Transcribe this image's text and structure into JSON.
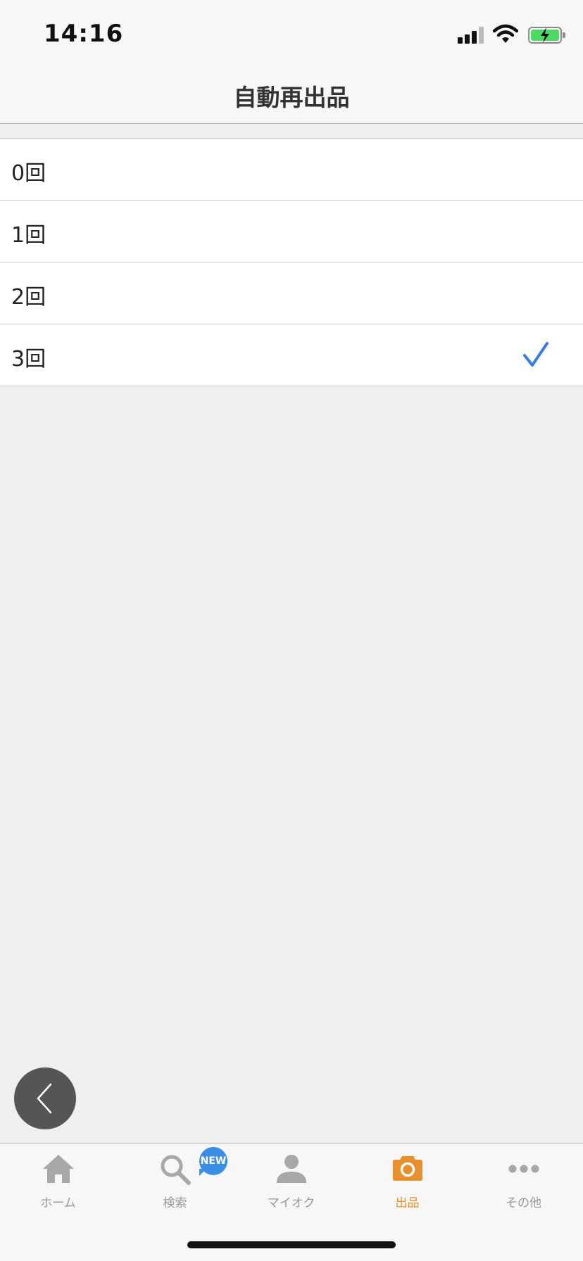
{
  "status_bar": {
    "time": "14:16"
  },
  "nav": {
    "title": "自動再出品"
  },
  "options": [
    {
      "label": "0回",
      "selected": false
    },
    {
      "label": "1回",
      "selected": false
    },
    {
      "label": "2回",
      "selected": false
    },
    {
      "label": "3回",
      "selected": true
    }
  ],
  "tabs": [
    {
      "label": "ホーム",
      "icon": "home-icon"
    },
    {
      "label": "検索",
      "icon": "search-icon",
      "badge": "NEW"
    },
    {
      "label": "マイオク",
      "icon": "person-icon"
    },
    {
      "label": "出品",
      "icon": "camera-icon",
      "active": true
    },
    {
      "label": "その他",
      "icon": "more-icon"
    }
  ],
  "colors": {
    "accent_active": "#e8902e",
    "check": "#3a7be0",
    "badge": "#3a8ee6",
    "tab_inactive": "#999999",
    "background": "#efefef"
  }
}
